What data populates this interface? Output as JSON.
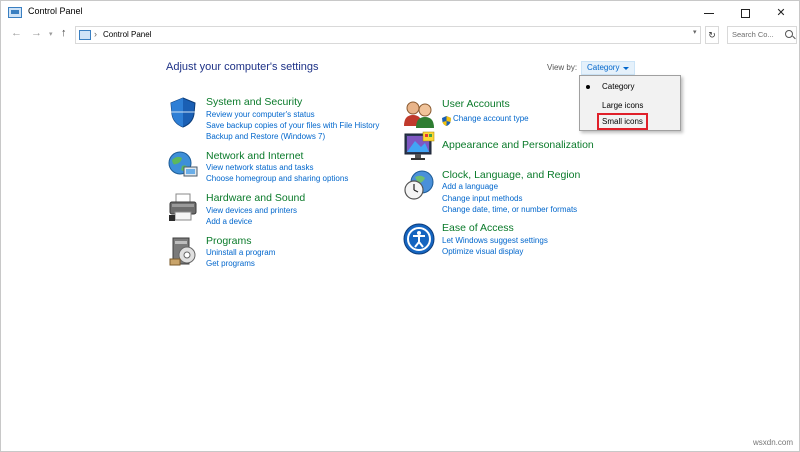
{
  "window": {
    "title": "Control Panel",
    "icon": "control-panel-icon",
    "controls": [
      "minimize",
      "maximize",
      "close"
    ]
  },
  "address_bar": {
    "path": "Control Panel",
    "search_placeholder": "Search Co..."
  },
  "main": {
    "heading": "Adjust your computer's settings",
    "view_by_label": "View by:",
    "view_by_value": "Category",
    "view_options": [
      {
        "label": "Category",
        "selected": true
      },
      {
        "label": "Large icons",
        "selected": false
      },
      {
        "label": "Small icons",
        "selected": false,
        "highlighted": true
      }
    ],
    "highlight_color": "#e0202a"
  },
  "categories": [
    {
      "title": "System and Security",
      "icon": "shield-icon",
      "links": [
        "Review your computer's status",
        "Save backup copies of your files with File History",
        "Backup and Restore (Windows 7)"
      ]
    },
    {
      "title": "Network and Internet",
      "icon": "globe-network-icon",
      "links": [
        "View network status and tasks",
        "Choose homegroup and sharing options"
      ]
    },
    {
      "title": "Hardware and Sound",
      "icon": "printer-icon",
      "links": [
        "View devices and printers",
        "Add a device"
      ]
    },
    {
      "title": "Programs",
      "icon": "programs-icon",
      "links": [
        "Uninstall a program",
        "Get programs"
      ]
    },
    {
      "title": "User Accounts",
      "icon": "users-icon",
      "links": [
        "Change account type"
      ]
    },
    {
      "title": "Appearance and Personalization",
      "icon": "monitor-icon",
      "links": []
    },
    {
      "title": "Clock, Language, and Region",
      "icon": "clock-globe-icon",
      "links": [
        "Add a language",
        "Change input methods",
        "Change date, time, or number formats"
      ]
    },
    {
      "title": "Ease of Access",
      "icon": "ease-of-access-icon",
      "links": [
        "Let Windows suggest settings",
        "Optimize visual display"
      ]
    }
  ],
  "colors": {
    "category_title": "#0a7a2a",
    "link": "#0066cc",
    "heading": "#1e3287"
  },
  "watermark": "wsxdn.com"
}
